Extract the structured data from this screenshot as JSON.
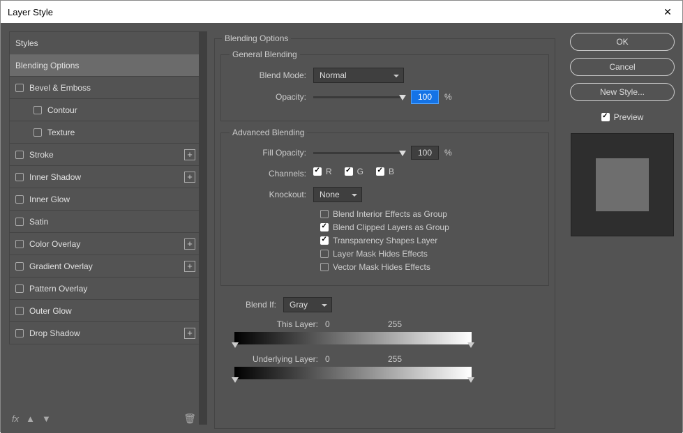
{
  "window": {
    "title": "Layer Style",
    "close_glyph": "✕"
  },
  "sidebar": {
    "header": "Styles",
    "items": [
      {
        "label": "Blending Options",
        "checkbox": false,
        "selected": true,
        "sub": false,
        "plus": false
      },
      {
        "label": "Bevel & Emboss",
        "checkbox": true,
        "selected": false,
        "sub": false,
        "plus": false
      },
      {
        "label": "Contour",
        "checkbox": true,
        "selected": false,
        "sub": true,
        "plus": false
      },
      {
        "label": "Texture",
        "checkbox": true,
        "selected": false,
        "sub": true,
        "plus": false
      },
      {
        "label": "Stroke",
        "checkbox": true,
        "selected": false,
        "sub": false,
        "plus": true
      },
      {
        "label": "Inner Shadow",
        "checkbox": true,
        "selected": false,
        "sub": false,
        "plus": true
      },
      {
        "label": "Inner Glow",
        "checkbox": true,
        "selected": false,
        "sub": false,
        "plus": false
      },
      {
        "label": "Satin",
        "checkbox": true,
        "selected": false,
        "sub": false,
        "plus": false
      },
      {
        "label": "Color Overlay",
        "checkbox": true,
        "selected": false,
        "sub": false,
        "plus": true
      },
      {
        "label": "Gradient Overlay",
        "checkbox": true,
        "selected": false,
        "sub": false,
        "plus": true
      },
      {
        "label": "Pattern Overlay",
        "checkbox": true,
        "selected": false,
        "sub": false,
        "plus": false
      },
      {
        "label": "Outer Glow",
        "checkbox": true,
        "selected": false,
        "sub": false,
        "plus": false
      },
      {
        "label": "Drop Shadow",
        "checkbox": true,
        "selected": false,
        "sub": false,
        "plus": true
      }
    ],
    "footer": {
      "fx": "fx",
      "up": "▲",
      "down": "▼",
      "trash": "🗑"
    }
  },
  "main": {
    "title": "Blending Options",
    "general": {
      "title": "General Blending",
      "blend_mode_label": "Blend Mode:",
      "blend_mode_value": "Normal",
      "opacity_label": "Opacity:",
      "opacity_value": "100",
      "opacity_pct": "%"
    },
    "advanced": {
      "title": "Advanced Blending",
      "fill_opacity_label": "Fill Opacity:",
      "fill_opacity_value": "100",
      "fill_opacity_pct": "%",
      "channels_label": "Channels:",
      "channels": {
        "r_label": "R",
        "r": true,
        "g_label": "G",
        "g": true,
        "b_label": "B",
        "b": true
      },
      "knockout_label": "Knockout:",
      "knockout_value": "None",
      "opts": [
        {
          "label": "Blend Interior Effects as Group",
          "checked": false
        },
        {
          "label": "Blend Clipped Layers as Group",
          "checked": true
        },
        {
          "label": "Transparency Shapes Layer",
          "checked": true
        },
        {
          "label": "Layer Mask Hides Effects",
          "checked": false
        },
        {
          "label": "Vector Mask Hides Effects",
          "checked": false
        }
      ]
    },
    "blendif": {
      "label": "Blend If:",
      "value": "Gray",
      "this_layer_label": "This Layer:",
      "this_lo": "0",
      "this_hi": "255",
      "under_label": "Underlying Layer:",
      "under_lo": "0",
      "under_hi": "255"
    }
  },
  "right": {
    "ok": "OK",
    "cancel": "Cancel",
    "new_style": "New Style...",
    "preview_label": "Preview",
    "preview_checked": true
  }
}
